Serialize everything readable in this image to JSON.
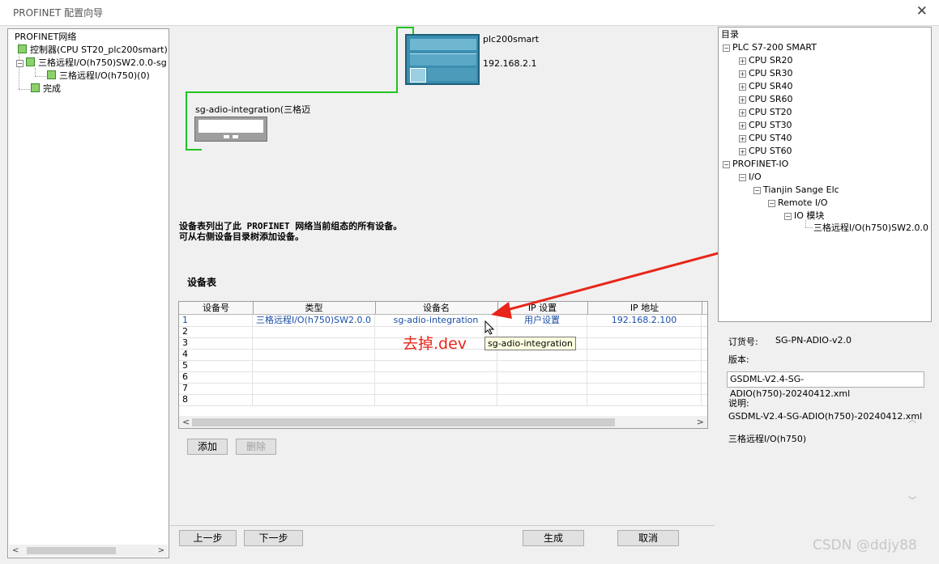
{
  "window": {
    "title": "PROFINET 配置向导",
    "close_glyph": "✕"
  },
  "left_tree": {
    "root": "PROFINET网络",
    "controller": "控制器(CPU ST20_plc200smart)",
    "device": "三格远程I/O(h750)SW2.0.0-sg",
    "device_child": "三格远程I/O(h750)(0)",
    "finish": "完成"
  },
  "network": {
    "plc_name": "plc200smart",
    "plc_ip": "192.168.2.1",
    "device_label": "sg-adio-integration(三格迈"
  },
  "description": {
    "line1": "设备表列出了此 PROFINET 网络当前组态的所有设备。",
    "line2": "可从右侧设备目录树添加设备。"
  },
  "device_table": {
    "title": "设备表",
    "headers": [
      "设备号",
      "类型",
      "设备名",
      "IP 设置",
      "IP 地址"
    ],
    "rows": [
      {
        "num": "1",
        "type": "三格远程I/O(h750)SW2.0.0",
        "name": "sg-adio-integration",
        "ip_setting": "用户设置",
        "ip": "192.168.2.100"
      },
      {
        "num": "2",
        "type": "",
        "name": "",
        "ip_setting": "",
        "ip": ""
      },
      {
        "num": "3",
        "type": "",
        "name": "",
        "ip_setting": "",
        "ip": ""
      },
      {
        "num": "4",
        "type": "",
        "name": "",
        "ip_setting": "",
        "ip": ""
      },
      {
        "num": "5",
        "type": "",
        "name": "",
        "ip_setting": "",
        "ip": ""
      },
      {
        "num": "6",
        "type": "",
        "name": "",
        "ip_setting": "",
        "ip": ""
      },
      {
        "num": "7",
        "type": "",
        "name": "",
        "ip_setting": "",
        "ip": ""
      },
      {
        "num": "8",
        "type": "",
        "name": "",
        "ip_setting": "",
        "ip": ""
      }
    ]
  },
  "buttons": {
    "add": "添加",
    "delete": "删除",
    "prev": "上一步",
    "next": "下一步",
    "generate": "生成",
    "cancel": "取消"
  },
  "tooltip": "sg-adio-integration",
  "annotation": "去掉.dev",
  "catalog": {
    "title": "目录",
    "plc_group": "PLC S7-200 SMART",
    "cpus": [
      "CPU SR20",
      "CPU SR30",
      "CPU SR40",
      "CPU SR60",
      "CPU ST20",
      "CPU ST30",
      "CPU ST40",
      "CPU ST60"
    ],
    "profinet_io": "PROFINET-IO",
    "io": "I/O",
    "vendor": "Tianjin Sange Elc",
    "remote_io": "Remote I/O",
    "io_module": "IO 模块",
    "selected_item": "三格远程I/O(h750)SW2.0.0"
  },
  "details": {
    "order_label": "订货号:",
    "order_value": "SG-PN-ADIO-v2.0",
    "version_label": "版本:",
    "version_value": "GSDML-V2.4-SG-ADIO(h750)-20240412.xml",
    "desc_label": "说明:",
    "desc_line1": "GSDML-V2.4-SG-ADIO(h750)-20240412.xml",
    "desc_line2": "三格远程I/O(h750)"
  },
  "watermark": "CSDN @ddjy88",
  "colors": {
    "link_wire": "#22c322",
    "annotation": "#e8251a",
    "table_text_blue": "#1a4ea8"
  }
}
